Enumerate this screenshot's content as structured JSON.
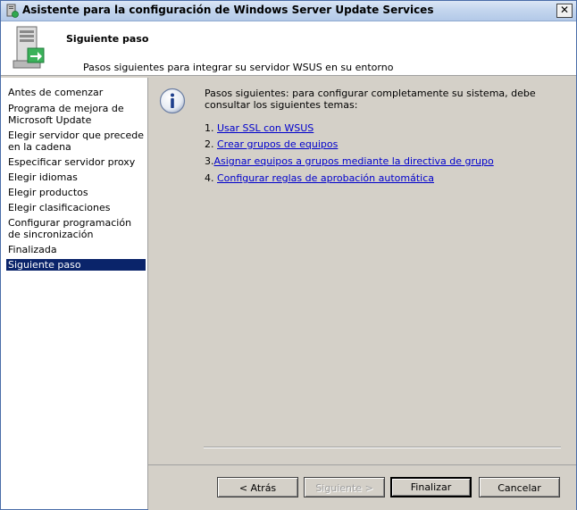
{
  "window": {
    "title": "Asistente para la configuración de Windows Server Update Services",
    "close_symbol": "✕"
  },
  "header": {
    "title": "Siguiente paso",
    "subtitle": "Pasos siguientes para integrar su servidor WSUS en su entorno",
    "icon": "server-setup-icon"
  },
  "sidebar": {
    "items": [
      {
        "label": "Antes de comenzar"
      },
      {
        "label": "Programa de mejora de Microsoft Update"
      },
      {
        "label": "Elegir servidor que precede en la cadena"
      },
      {
        "label": "Especificar servidor proxy"
      },
      {
        "label": "Elegir idiomas"
      },
      {
        "label": "Elegir productos"
      },
      {
        "label": "Elegir clasificaciones"
      },
      {
        "label": "Configurar programación de sincronización"
      },
      {
        "label": "Finalizada"
      },
      {
        "label": "Siguiente paso",
        "active": true
      }
    ]
  },
  "content": {
    "intro": "Pasos siguientes: para configurar completamente su sistema, debe consultar los siguientes temas:",
    "steps": [
      {
        "number": "1.",
        "link": "Usar SSL con WSUS"
      },
      {
        "number": "2.",
        "link": "Crear grupos de equipos"
      },
      {
        "number": "3.",
        "link": "Asignar equipos a grupos mediante la directiva de grupo"
      },
      {
        "number": "4.",
        "link": "Configurar reglas de aprobación automática"
      }
    ],
    "icon": "info-icon"
  },
  "footer": {
    "back_label": "< Atrás",
    "next_label": "Siguiente >",
    "finish_label": "Finalizar",
    "cancel_label": "Cancelar"
  },
  "colors": {
    "selection": "#0a246a",
    "link": "#0000cc",
    "dialog_bg": "#d4d0c8"
  }
}
